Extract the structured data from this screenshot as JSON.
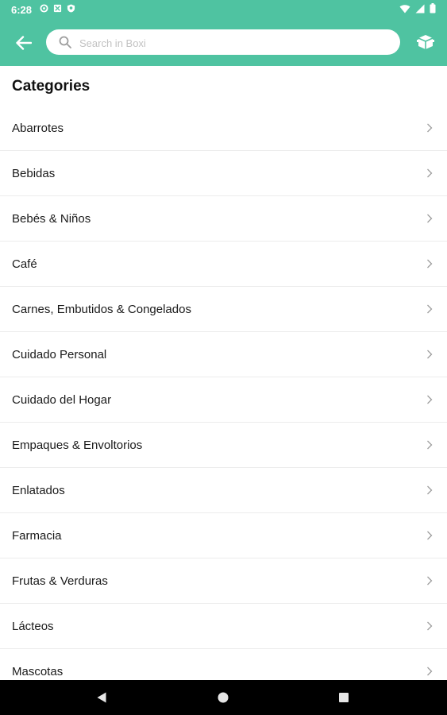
{
  "status_bar": {
    "time": "6:28",
    "left_icons": [
      "settings-icon",
      "notification-icon",
      "shield-icon"
    ],
    "right_icons": [
      "wifi-icon",
      "signal-icon",
      "battery-icon"
    ]
  },
  "app_bar": {
    "background_color": "#4fc3a1",
    "back_icon": "arrow-left-icon",
    "search_placeholder": "Search in Boxi",
    "search_value": "",
    "box_icon": "box-icon"
  },
  "page": {
    "title": "Categories"
  },
  "categories": [
    {
      "label": "Abarrotes"
    },
    {
      "label": "Bebidas"
    },
    {
      "label": "Bebés & Niños"
    },
    {
      "label": "Café"
    },
    {
      "label": "Carnes, Embutidos & Congelados"
    },
    {
      "label": "Cuidado Personal"
    },
    {
      "label": "Cuidado del Hogar"
    },
    {
      "label": "Empaques & Envoltorios"
    },
    {
      "label": "Enlatados"
    },
    {
      "label": "Farmacia"
    },
    {
      "label": "Frutas & Verduras"
    },
    {
      "label": "Lácteos"
    },
    {
      "label": "Mascotas"
    }
  ],
  "nav_bar": {
    "buttons": [
      "back-triangle-icon",
      "home-circle-icon",
      "recents-square-icon"
    ]
  }
}
